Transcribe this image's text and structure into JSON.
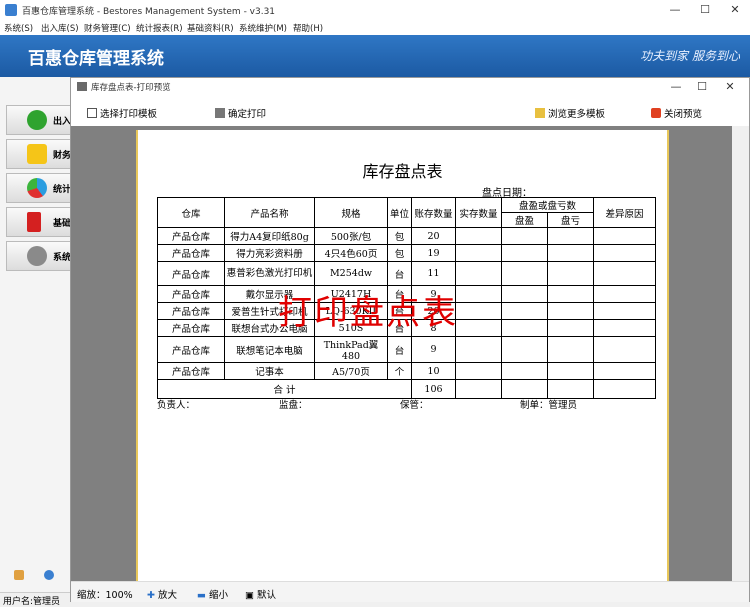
{
  "window": {
    "title": "百惠仓库管理系统 - Bestores Management System - v3.31",
    "min": "—",
    "max": "☐",
    "close": "✕"
  },
  "menu": [
    "系统(S)",
    "出入库(S)",
    "财务管理(C)",
    "统计报表(R)",
    "基础资料(R)",
    "系统维护(M)",
    "帮助(H)"
  ],
  "header": {
    "brand": "百惠仓库管理系统",
    "slogan": "功夫到家 服务到心"
  },
  "sidebar": {
    "items": [
      {
        "label": "出入",
        "icon": "check-icon"
      },
      {
        "label": "财务",
        "icon": "star-icon"
      },
      {
        "label": "统计",
        "icon": "pie-icon"
      },
      {
        "label": "基础",
        "icon": "book-icon"
      },
      {
        "label": "系统",
        "icon": "gear-icon"
      }
    ]
  },
  "status": {
    "user": "用户名:管理员"
  },
  "dialog": {
    "title": "库存盘点表-打印预览",
    "toolbar": {
      "select_template": "选择打印模板",
      "confirm_print": "确定打印",
      "browse_more": "浏览更多模板",
      "close_preview": "关闭预览"
    },
    "bottom": {
      "zoom": "缩放：100%",
      "zoom_in": "放大",
      "zoom_out": "缩小",
      "default": "默认"
    }
  },
  "report": {
    "title": "库存盘点表",
    "date_label": "盘点日期：",
    "headers": {
      "warehouse": "仓库",
      "product": "产品名称",
      "spec": "规格",
      "unit": "单位",
      "book_qty": "账存数量",
      "actual_qty": "实存数量",
      "diff": "盘盈或盘亏数",
      "gain": "盘盈",
      "loss": "盘亏",
      "reason": "差异原因"
    },
    "rows": [
      [
        "产品仓库",
        "得力A4复印纸80g",
        "500张/包",
        "包",
        "20"
      ],
      [
        "产品仓库",
        "得力亮彩资料册",
        "4只4色60页",
        "包",
        "19"
      ],
      [
        "产品仓库",
        "惠普彩色激光打印机",
        "M254dw",
        "台",
        "11"
      ],
      [
        "产品仓库",
        "戴尔显示器",
        "U2417H",
        "台",
        "9"
      ],
      [
        "产品仓库",
        "爱普生针式打印机",
        "LQ-630KII",
        "台",
        "20"
      ],
      [
        "产品仓库",
        "联想台式办公电脑",
        "510S",
        "台",
        "8"
      ],
      [
        "产品仓库",
        "联想笔记本电脑",
        "ThinkPad翼480",
        "台",
        "9"
      ],
      [
        "产品仓库",
        "记事本",
        "A5/70页",
        "个",
        "10"
      ]
    ],
    "total_label": "合  计",
    "total": "106",
    "footer": {
      "manager": "负责人：",
      "supervisor": "监盘：",
      "keeper": "保管：",
      "maker": "制单：管理员"
    },
    "watermark": "打印盘点表"
  }
}
